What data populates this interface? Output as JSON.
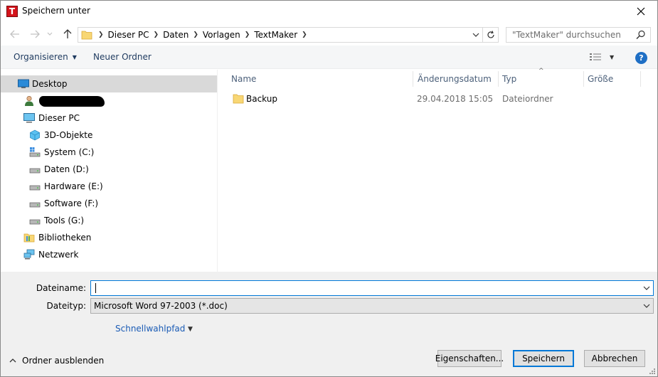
{
  "window": {
    "app_icon_letter": "T",
    "title": "Speichern unter"
  },
  "address": {
    "crumbs": [
      "Dieser PC",
      "Daten",
      "Vorlagen",
      "TextMaker"
    ]
  },
  "search": {
    "placeholder": "\"TextMaker\" durchsuchen"
  },
  "toolbar": {
    "organize_label": "Organisieren",
    "new_folder_label": "Neuer Ordner",
    "help_label": "?"
  },
  "nav_tree": [
    {
      "label": "Desktop",
      "icon": "desktop-icon",
      "selected": true
    },
    {
      "label": "",
      "icon": "user-icon",
      "redacted": true
    },
    {
      "label": "Dieser PC",
      "icon": "computer-icon"
    },
    {
      "label": "3D-Objekte",
      "icon": "cube-icon"
    },
    {
      "label": "System (C:)",
      "icon": "drive-icon"
    },
    {
      "label": "Daten (D:)",
      "icon": "drive-icon"
    },
    {
      "label": "Hardware (E:)",
      "icon": "drive-icon"
    },
    {
      "label": "Software (F:)",
      "icon": "drive-icon"
    },
    {
      "label": "Tools (G:)",
      "icon": "drive-icon"
    },
    {
      "label": "Bibliotheken",
      "icon": "library-icon"
    },
    {
      "label": "Netzwerk",
      "icon": "network-icon"
    }
  ],
  "columns": {
    "name": "Name",
    "date": "Änderungsdatum",
    "type": "Typ",
    "size": "Größe"
  },
  "files": [
    {
      "name": "Backup",
      "date": "29.04.2018 15:05",
      "type": "Dateiordner",
      "size": ""
    }
  ],
  "form": {
    "filename_label": "Dateiname:",
    "filename_value": "",
    "filetype_label": "Dateityp:",
    "filetype_value": "Microsoft Word 97-2003 (*.doc)",
    "quick_path_label": "Schnellwahlpfad"
  },
  "footer": {
    "hide_folders_label": "Ordner ausblenden",
    "properties_label": "Eigenschaften...",
    "save_label": "Speichern",
    "cancel_label": "Abbrechen"
  },
  "colors": {
    "accent": "#0078d7",
    "app_icon": "#d4141b",
    "selection": "#d9d9d9",
    "panel": "#f0f0f0",
    "link": "#1a5bb5"
  }
}
